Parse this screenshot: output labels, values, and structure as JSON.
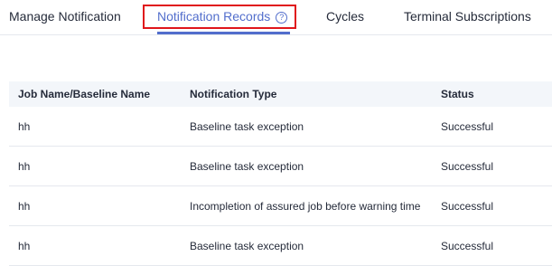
{
  "tabs": {
    "manage": "Manage Notification",
    "records": "Notification Records",
    "cycles": "Cycles",
    "terminal": "Terminal Subscriptions",
    "help_icon": "?",
    "active_color": "#526ecc",
    "highlight_color": "#e0161b"
  },
  "table": {
    "headers": [
      "Job Name/Baseline Name",
      "Notification Type",
      "Status"
    ],
    "rows": [
      {
        "name": "hh",
        "type": "Baseline task exception",
        "status": "Successful"
      },
      {
        "name": "hh",
        "type": "Baseline task exception",
        "status": "Successful"
      },
      {
        "name": "hh",
        "type": "Incompletion of assured job before warning time",
        "status": "Successful"
      },
      {
        "name": "hh",
        "type": "Baseline task exception",
        "status": "Successful"
      }
    ]
  }
}
